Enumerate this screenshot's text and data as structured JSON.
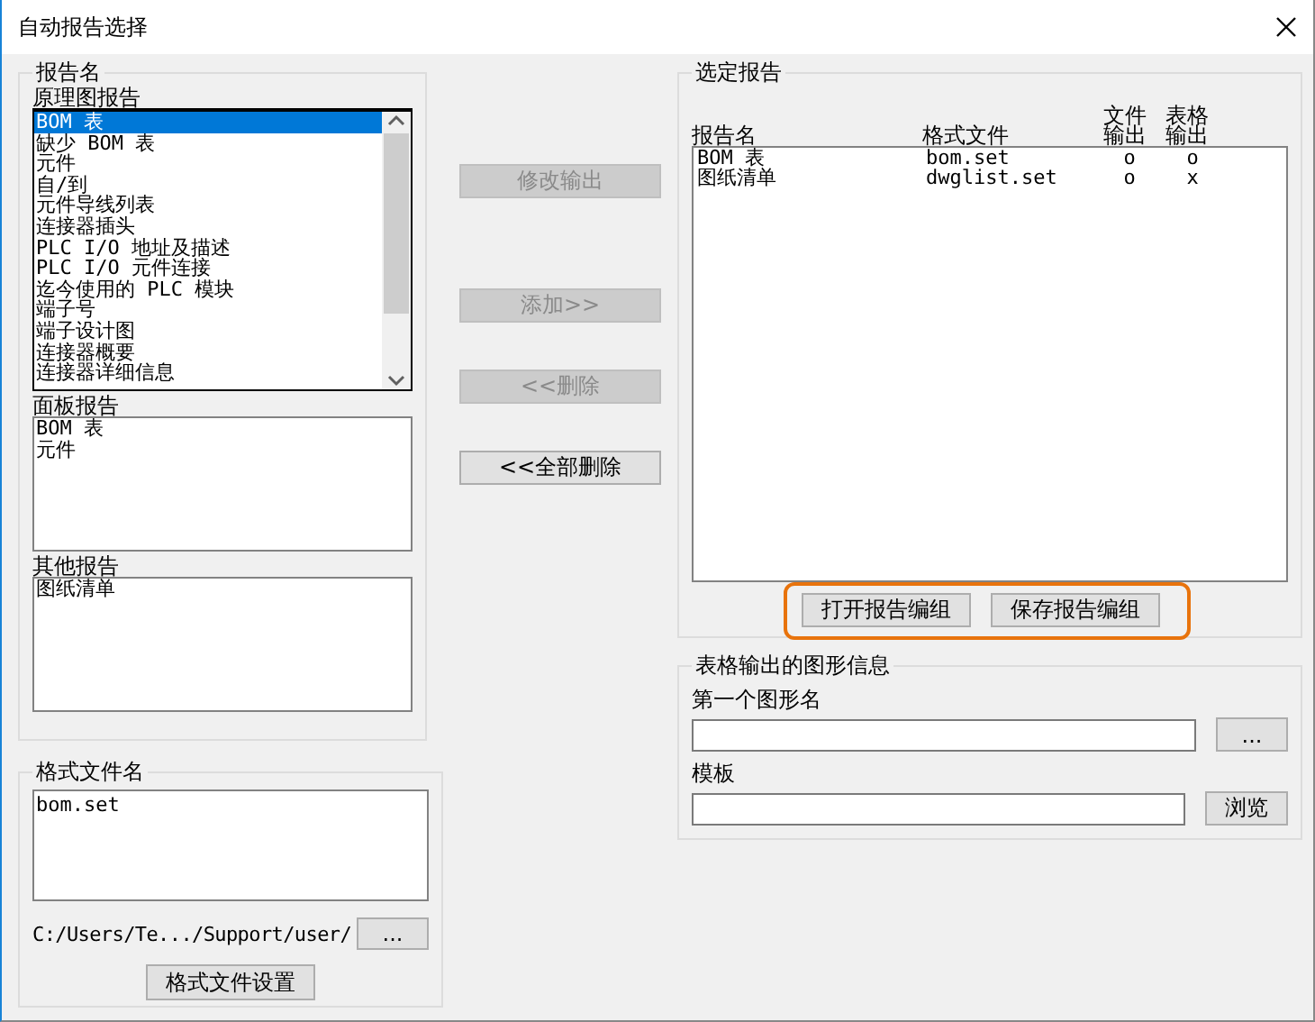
{
  "window": {
    "title": "自动报告选择"
  },
  "report_names": {
    "title": "报告名",
    "schematic": {
      "label": "原理图报告",
      "items": [
        {
          "label": "BOM 表",
          "selected": true
        },
        {
          "label": "缺少 BOM 表",
          "selected": false
        },
        {
          "label": "元件",
          "selected": false
        },
        {
          "label": "自/到",
          "selected": false
        },
        {
          "label": "元件导线列表",
          "selected": false
        },
        {
          "label": "连接器插头",
          "selected": false
        },
        {
          "label": "PLC I/O 地址及描述",
          "selected": false
        },
        {
          "label": "PLC I/O 元件连接",
          "selected": false
        },
        {
          "label": "迄今使用的 PLC 模块",
          "selected": false
        },
        {
          "label": "端子号",
          "selected": false
        },
        {
          "label": "端子设计图",
          "selected": false
        },
        {
          "label": "连接器概要",
          "selected": false
        },
        {
          "label": "连接器详细信息",
          "selected": false
        }
      ]
    },
    "panel": {
      "label": "面板报告",
      "items": [
        "BOM 表",
        "元件"
      ]
    },
    "other": {
      "label": "其他报告",
      "items": [
        "图纸清单"
      ]
    }
  },
  "middle_buttons": [
    {
      "label": "修改输出",
      "disabled": true
    },
    {
      "label": "添加>>",
      "disabled": true
    },
    {
      "label": "<<删除",
      "disabled": true
    },
    {
      "label": "<<全部删除",
      "disabled": false
    }
  ],
  "format_file": {
    "title": "格式文件名",
    "items": [
      "bom.set"
    ],
    "path": "C:/Users/Te.../Support/user/",
    "browse_button": "...",
    "settings_button": "格式文件设置"
  },
  "selected_reports": {
    "title": "选定报告",
    "columns": [
      "报告名",
      "格式文件",
      "文件输出",
      "表格输出"
    ],
    "rows": [
      {
        "name": "BOM 表",
        "format": "bom.set",
        "file_output": "o",
        "table_output": "o"
      },
      {
        "name": "图纸清单",
        "format": "dwglist.set",
        "file_output": "o",
        "table_output": "x"
      }
    ],
    "buttons": [
      "打开报告编组",
      "保存报告编组"
    ],
    "buttons_highlighted": true
  },
  "graphic_info": {
    "title": "表格输出的图形信息",
    "first_graphic_label": "第一个图形名",
    "first_graphic_button": "...",
    "template_label": "模板",
    "template_button": "浏览"
  }
}
